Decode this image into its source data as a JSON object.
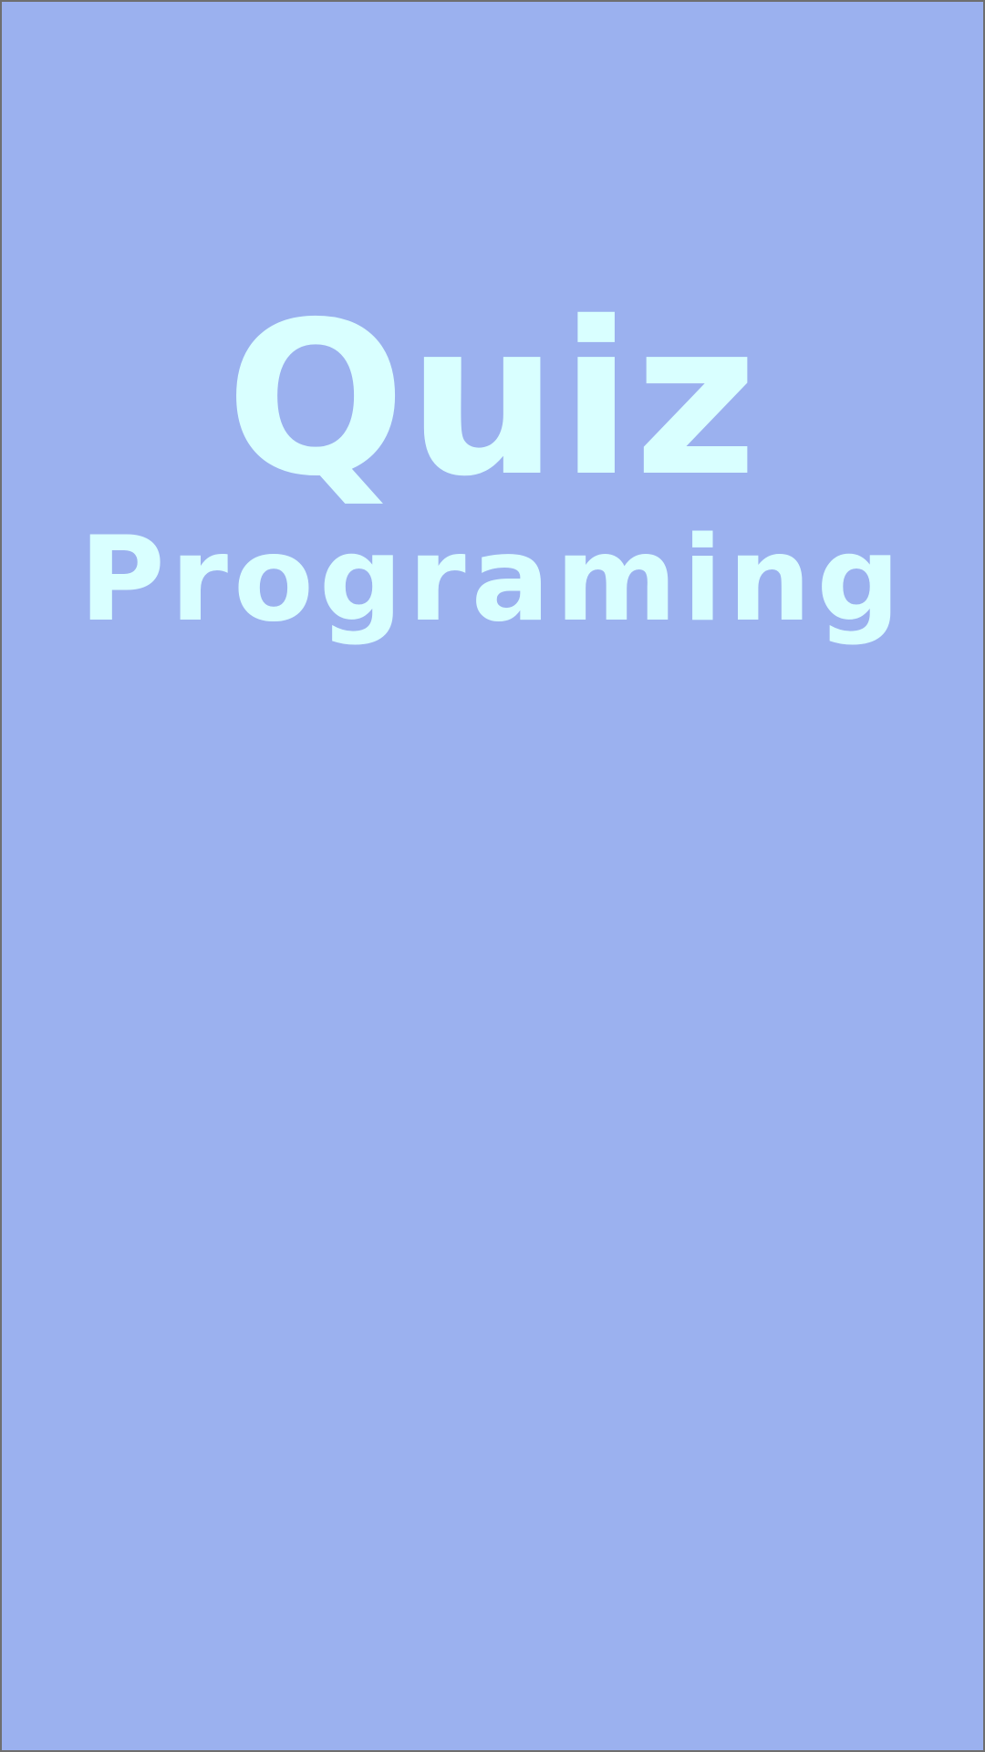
{
  "splash": {
    "title": "Quiz",
    "subtitle": "Programing"
  },
  "colors": {
    "background": "#9bb1ef",
    "text": "#d9ffff",
    "border": "#6f6f6f"
  }
}
